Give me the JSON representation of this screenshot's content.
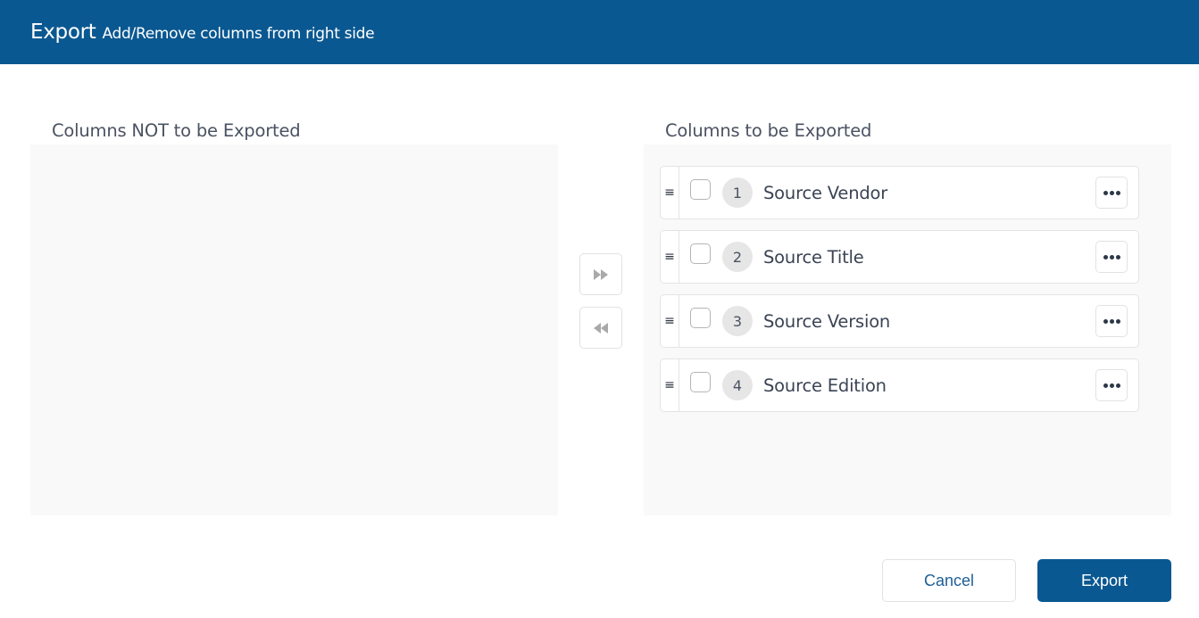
{
  "header": {
    "title": "Export",
    "subtitle": "Add/Remove columns from right side"
  },
  "left_panel": {
    "label": "Columns NOT to be Exported",
    "items": []
  },
  "right_panel": {
    "label": "Columns to be Exported",
    "items": [
      {
        "index": "1",
        "label": "Source Vendor",
        "checked": false
      },
      {
        "index": "2",
        "label": "Source Title",
        "checked": false
      },
      {
        "index": "3",
        "label": "Source Version",
        "checked": false
      },
      {
        "index": "4",
        "label": "Source Edition",
        "checked": false
      }
    ]
  },
  "transfer": {
    "move_right_icon": "double-chevron-right-icon",
    "move_left_icon": "double-chevron-left-icon"
  },
  "icons": {
    "drag": "≡",
    "more": "ellipsis-icon"
  },
  "footer": {
    "cancel_label": "Cancel",
    "export_label": "Export"
  },
  "colors": {
    "brand": "#0a5891",
    "panel_bg": "#f9f9f9"
  }
}
